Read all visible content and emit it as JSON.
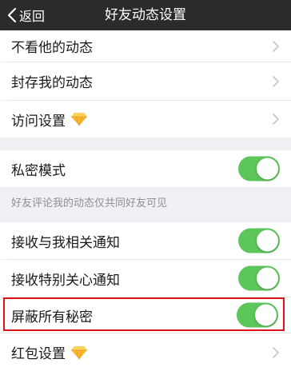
{
  "nav": {
    "back_label": "返回",
    "title": "好友动态设置"
  },
  "rows": {
    "hide_his_feed": "不看他的动态",
    "archive_my_feed": "封存我的动态",
    "visit_settings": "访问设置",
    "private_mode": "私密模式",
    "private_hint": "好友评论我的动态仅共同好友可见",
    "receive_related": "接收与我相关通知",
    "receive_special": "接收特别关心通知",
    "block_all_secrets": "屏蔽所有秘密",
    "red_packet_settings": "红包设置"
  },
  "toggles": {
    "private_mode": true,
    "receive_related": true,
    "receive_special": true,
    "block_all_secrets": true
  },
  "colors": {
    "navbar": "#2b2b2d",
    "toggle_on": "#5dc65a",
    "highlight": "#e0121a",
    "gem": "#f5a623"
  },
  "icons": {
    "vip_badge": "diamond-icon",
    "chevron": "chevron-right-icon",
    "back": "chevron-left-icon"
  }
}
